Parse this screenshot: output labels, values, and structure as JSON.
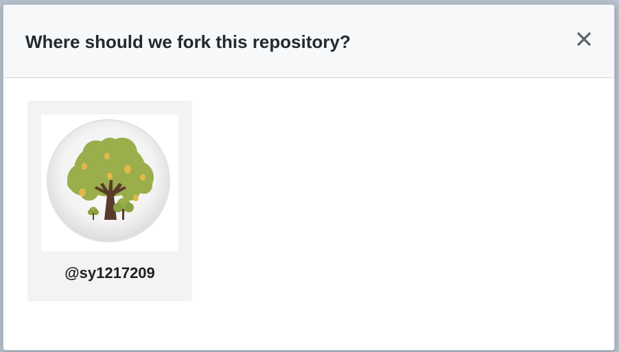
{
  "dialog": {
    "title": "Where should we fork this repository?",
    "close_icon": "close-x-icon"
  },
  "fork_targets": [
    {
      "account": "@sy1217209",
      "avatar_icon": "tree-avatar-icon"
    }
  ],
  "colors": {
    "header_bg": "#f6f8fa",
    "card_bg": "#f3f3f3",
    "tree_foliage": "#9aae4c",
    "tree_fruit": "#e3b94a",
    "tree_trunk": "#5a3b2a"
  }
}
